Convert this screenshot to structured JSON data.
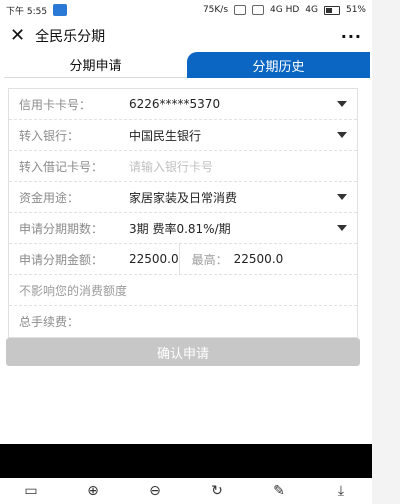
{
  "status_bar": {
    "time": "下午 5:55",
    "network_speed": "75K/s",
    "network": "4G HD",
    "network2": "4G",
    "battery": "51%"
  },
  "nav": {
    "title": "全民乐分期",
    "more": "···"
  },
  "tabs": [
    {
      "label": "分期申请",
      "active": true
    },
    {
      "label": "分期历史",
      "active": false
    }
  ],
  "form": {
    "credit_card": {
      "label": "信用卡卡号：",
      "value": "6226*****5370"
    },
    "bank": {
      "label": "转入银行：",
      "value": "中国民生银行"
    },
    "debit_card": {
      "label": "转入借记卡号：",
      "placeholder": "请输入银行卡号"
    },
    "purpose": {
      "label": "资金用途：",
      "value": "家居家装及日常消费"
    },
    "installments": {
      "label": "申请分期期数：",
      "value": "3期 费率0.81%/期"
    },
    "amount": {
      "label": "申请分期金额：",
      "value": "22500.0",
      "max_label": "最高：",
      "max_value": "22500.0"
    },
    "note": "不影响您的消费额度",
    "total_fee": {
      "label": "总手续费：",
      "value": ""
    }
  },
  "confirm": {
    "label": "确认申请"
  },
  "toolbar": {
    "icons": [
      "save-icon",
      "zoom-in-icon",
      "zoom-out-icon",
      "rotate-icon",
      "edit-icon",
      "download-icon"
    ],
    "glyphs": [
      "▭",
      "⊕",
      "⊖",
      "↻",
      "✎",
      "⤓"
    ]
  }
}
